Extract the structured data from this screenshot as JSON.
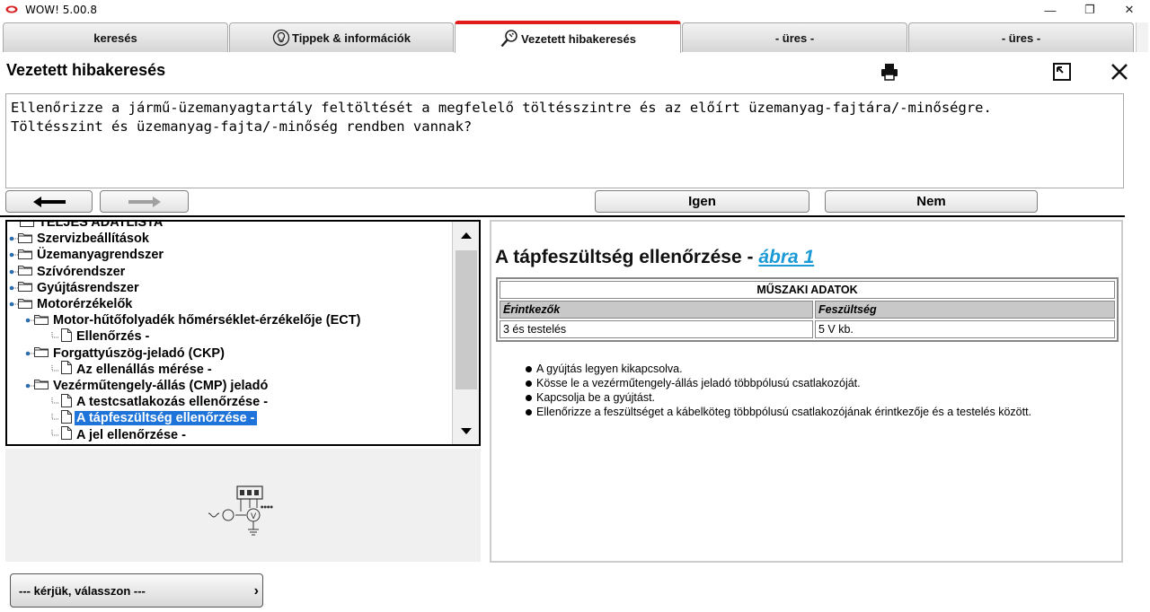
{
  "window": {
    "title": "WOW! 5.00.8",
    "controls": {
      "minimize": "—",
      "restore": "❐",
      "close": "✕"
    }
  },
  "tabs": [
    {
      "label": "keresés",
      "icon": "",
      "active": false
    },
    {
      "label": "Tippek & információk",
      "icon": "lightbulb-icon",
      "active": false
    },
    {
      "label": "Vezetett hibakeresés",
      "icon": "search-wrench-icon",
      "active": true
    },
    {
      "label": "- üres -",
      "icon": "",
      "active": false
    },
    {
      "label": "- üres -",
      "icon": "",
      "active": false
    }
  ],
  "header": {
    "title": "Vezetett hibakeresés",
    "icons": [
      "printer-icon",
      "minimize-window-icon",
      "close-icon"
    ]
  },
  "question": {
    "line1": "Ellenőrizze a jármű-üzemanyagtartály feltöltését a megfelelő töltésszintre és az előírt üzemanyag-fajtára/-minőségre.",
    "line2": "Töltésszint és üzemanyag-fajta/-minőség rendben vannak?"
  },
  "nav": {
    "back_icon": "arrow-left-icon",
    "forward_icon": "arrow-right-icon",
    "yes_label": "Igen",
    "no_label": "Nem"
  },
  "tree": {
    "items": [
      {
        "label": "TELJES ADATLISTA",
        "level": 0,
        "type": "folder"
      },
      {
        "label": "Szervizbeállítások",
        "level": 0,
        "type": "folder"
      },
      {
        "label": "Üzemanyagrendszer",
        "level": 0,
        "type": "folder"
      },
      {
        "label": "Szívórendszer",
        "level": 0,
        "type": "folder"
      },
      {
        "label": "Gyújtásrendszer",
        "level": 0,
        "type": "folder"
      },
      {
        "label": "Motorérzékelők",
        "level": 0,
        "type": "folder"
      },
      {
        "label": "Motor-hűtőfolyadék hőmérséklet-érzékelője (ECT)",
        "level": 1,
        "type": "folder"
      },
      {
        "label": "Ellenőrzés -",
        "level": 2,
        "type": "doc"
      },
      {
        "label": "Forgattyúszög-jeladó (CKP)",
        "level": 1,
        "type": "folder"
      },
      {
        "label": "Az ellenállás mérése -",
        "level": 2,
        "type": "doc"
      },
      {
        "label": "Vezérműtengely-állás (CMP) jeladó",
        "level": 1,
        "type": "folder"
      },
      {
        "label": "A testcsatlakozás ellenőrzése -",
        "level": 2,
        "type": "doc"
      },
      {
        "label": "A tápfeszültség ellenőrzése -",
        "level": 2,
        "type": "doc",
        "selected": true
      },
      {
        "label": "A jel ellenőrzése -",
        "level": 2,
        "type": "doc"
      }
    ]
  },
  "content": {
    "title": "A tápfeszültség ellenőrzése -",
    "figure_link": "ábra 1",
    "spec": {
      "heading": "MŰSZAKI ADATOK",
      "columns": [
        "Érintkezők",
        "Feszültség"
      ],
      "rows": [
        [
          "3 és testelés",
          "5 V kb."
        ]
      ]
    },
    "steps": [
      "A gyújtás legyen kikapcsolva.",
      "Kösse le a vezérműtengely-állás jeladó többpólusú csatlakozóját.",
      "Kapcsolja be a gyújtást.",
      "Ellenőrizze a feszültséget a kábelköteg többpólusú csatlakozójának érintkezője és a testelés között."
    ]
  },
  "select": {
    "label": "--- kérjük, válasszon ---",
    "chevron": "›"
  },
  "colors": {
    "active_tab_accent": "#e21b1b",
    "selection": "#1e74d8",
    "link": "#1a9ad6",
    "spec_header_bg": "#c8c8c8"
  }
}
